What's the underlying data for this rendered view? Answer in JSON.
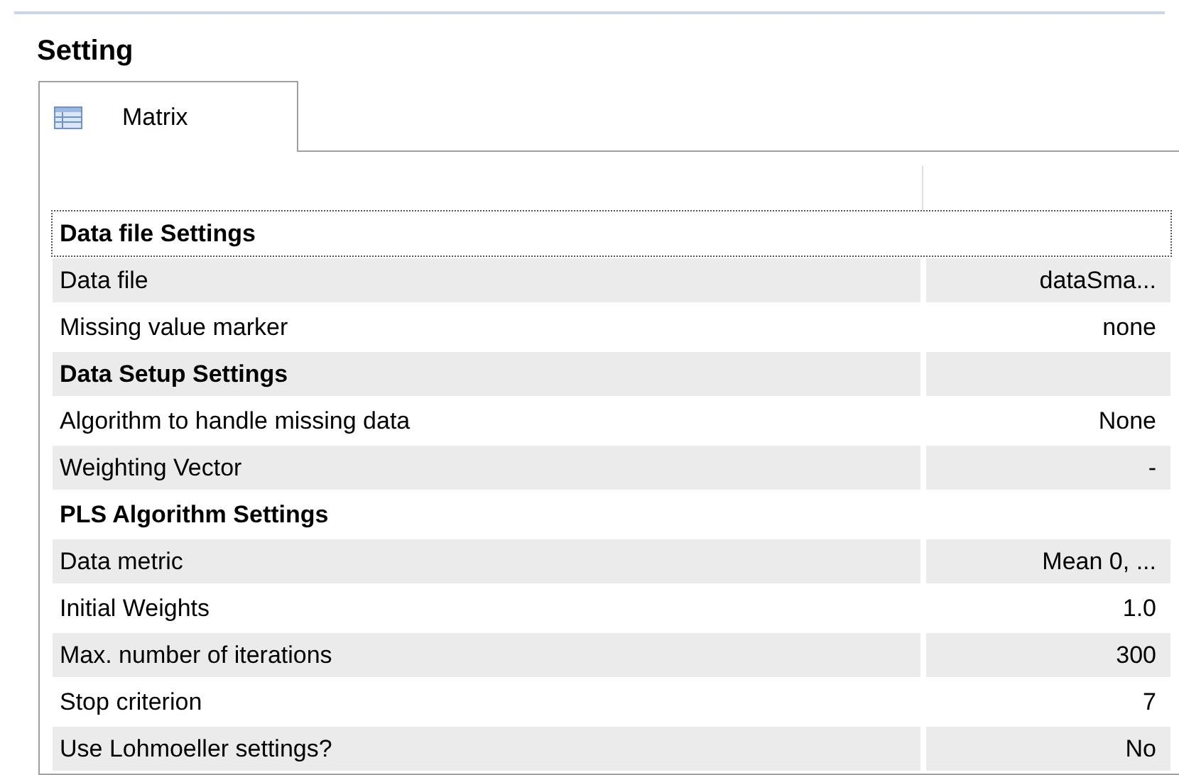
{
  "title": "Setting",
  "tabs": [
    {
      "label": "Matrix",
      "selected": true
    }
  ],
  "rows": [
    {
      "kind": "section",
      "label": "Data file Settings",
      "focused": true
    },
    {
      "kind": "property",
      "label": "Data file",
      "value": "dataSma...",
      "focused": false
    },
    {
      "kind": "property",
      "label": "Missing value marker",
      "value": "none",
      "focused": false
    },
    {
      "kind": "section",
      "label": "Data Setup Settings",
      "focused": false
    },
    {
      "kind": "property",
      "label": "Algorithm to handle missing data",
      "value": "None",
      "focused": false
    },
    {
      "kind": "property",
      "label": "Weighting Vector",
      "value": "-",
      "focused": false
    },
    {
      "kind": "section",
      "label": "PLS Algorithm Settings",
      "focused": false
    },
    {
      "kind": "property",
      "label": "Data metric",
      "value": "Mean 0, ...",
      "focused": false
    },
    {
      "kind": "property",
      "label": "Initial Weights",
      "value": "1.0",
      "focused": false
    },
    {
      "kind": "property",
      "label": "Max. number of iterations",
      "value": "300",
      "focused": false
    },
    {
      "kind": "property",
      "label": "Stop criterion",
      "value": "7",
      "focused": false
    },
    {
      "kind": "property",
      "label": "Use Lohmoeller settings?",
      "value": "No",
      "focused": false
    }
  ]
}
